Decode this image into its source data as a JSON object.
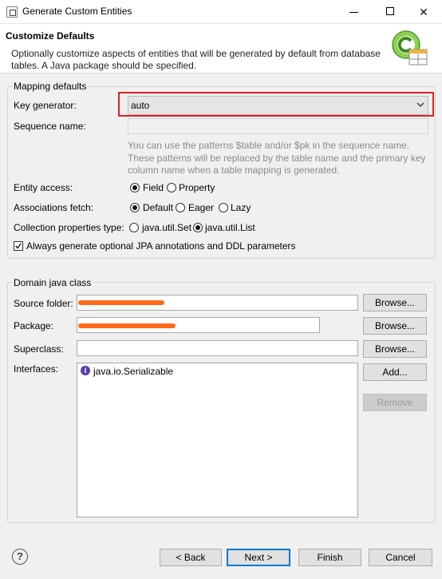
{
  "window": {
    "title": "Generate Custom Entities",
    "minimize_icon": "minimize-icon",
    "maximize_icon": "maximize-icon",
    "close_icon": "close-icon",
    "close_glyph": "✕"
  },
  "header": {
    "title": "Customize Defaults",
    "description": "Optionally customize aspects of entities that will be generated by default from database tables. A Java package should be specified."
  },
  "mapping": {
    "group_title": "Mapping defaults",
    "key_generator": {
      "label": "Key generator:",
      "value": "auto"
    },
    "sequence_name": {
      "label": "Sequence name:",
      "value": ""
    },
    "hint": "You can use the patterns $table and/or $pk in the sequence name. These patterns will be replaced by the table name and the primary key column name when a table mapping is generated.",
    "entity_access": {
      "label": "Entity access:",
      "options": [
        {
          "label": "Field",
          "selected": true
        },
        {
          "label": "Property",
          "selected": false
        }
      ]
    },
    "associations_fetch": {
      "label": "Associations fetch:",
      "options": [
        {
          "label": "Default",
          "selected": true
        },
        {
          "label": "Eager",
          "selected": false
        },
        {
          "label": "Lazy",
          "selected": false
        }
      ]
    },
    "collection_type": {
      "label": "Collection properties type:",
      "options": [
        {
          "label": "java.util.Set",
          "selected": false
        },
        {
          "label": "java.util.List",
          "selected": true
        }
      ]
    },
    "always_generate": {
      "label": "Always generate optional JPA annotations and DDL parameters",
      "checked": true
    }
  },
  "domain": {
    "group_title": "Domain java class",
    "source_folder": {
      "label": "Source folder:",
      "browse": "Browse..."
    },
    "package": {
      "label": "Package:",
      "browse": "Browse..."
    },
    "superclass": {
      "label": "Superclass:",
      "value": "",
      "browse": "Browse..."
    },
    "interfaces": {
      "label": "Interfaces:",
      "items": [
        "java.io.Serializable"
      ],
      "add": "Add...",
      "remove": "Remove"
    }
  },
  "footer": {
    "help": "?",
    "back": "< Back",
    "next": "Next >",
    "finish": "Finish",
    "cancel": "Cancel"
  },
  "colors": {
    "highlight": "#e02020",
    "redaction": "#ff6a1a",
    "primary_border": "#0078d7"
  }
}
